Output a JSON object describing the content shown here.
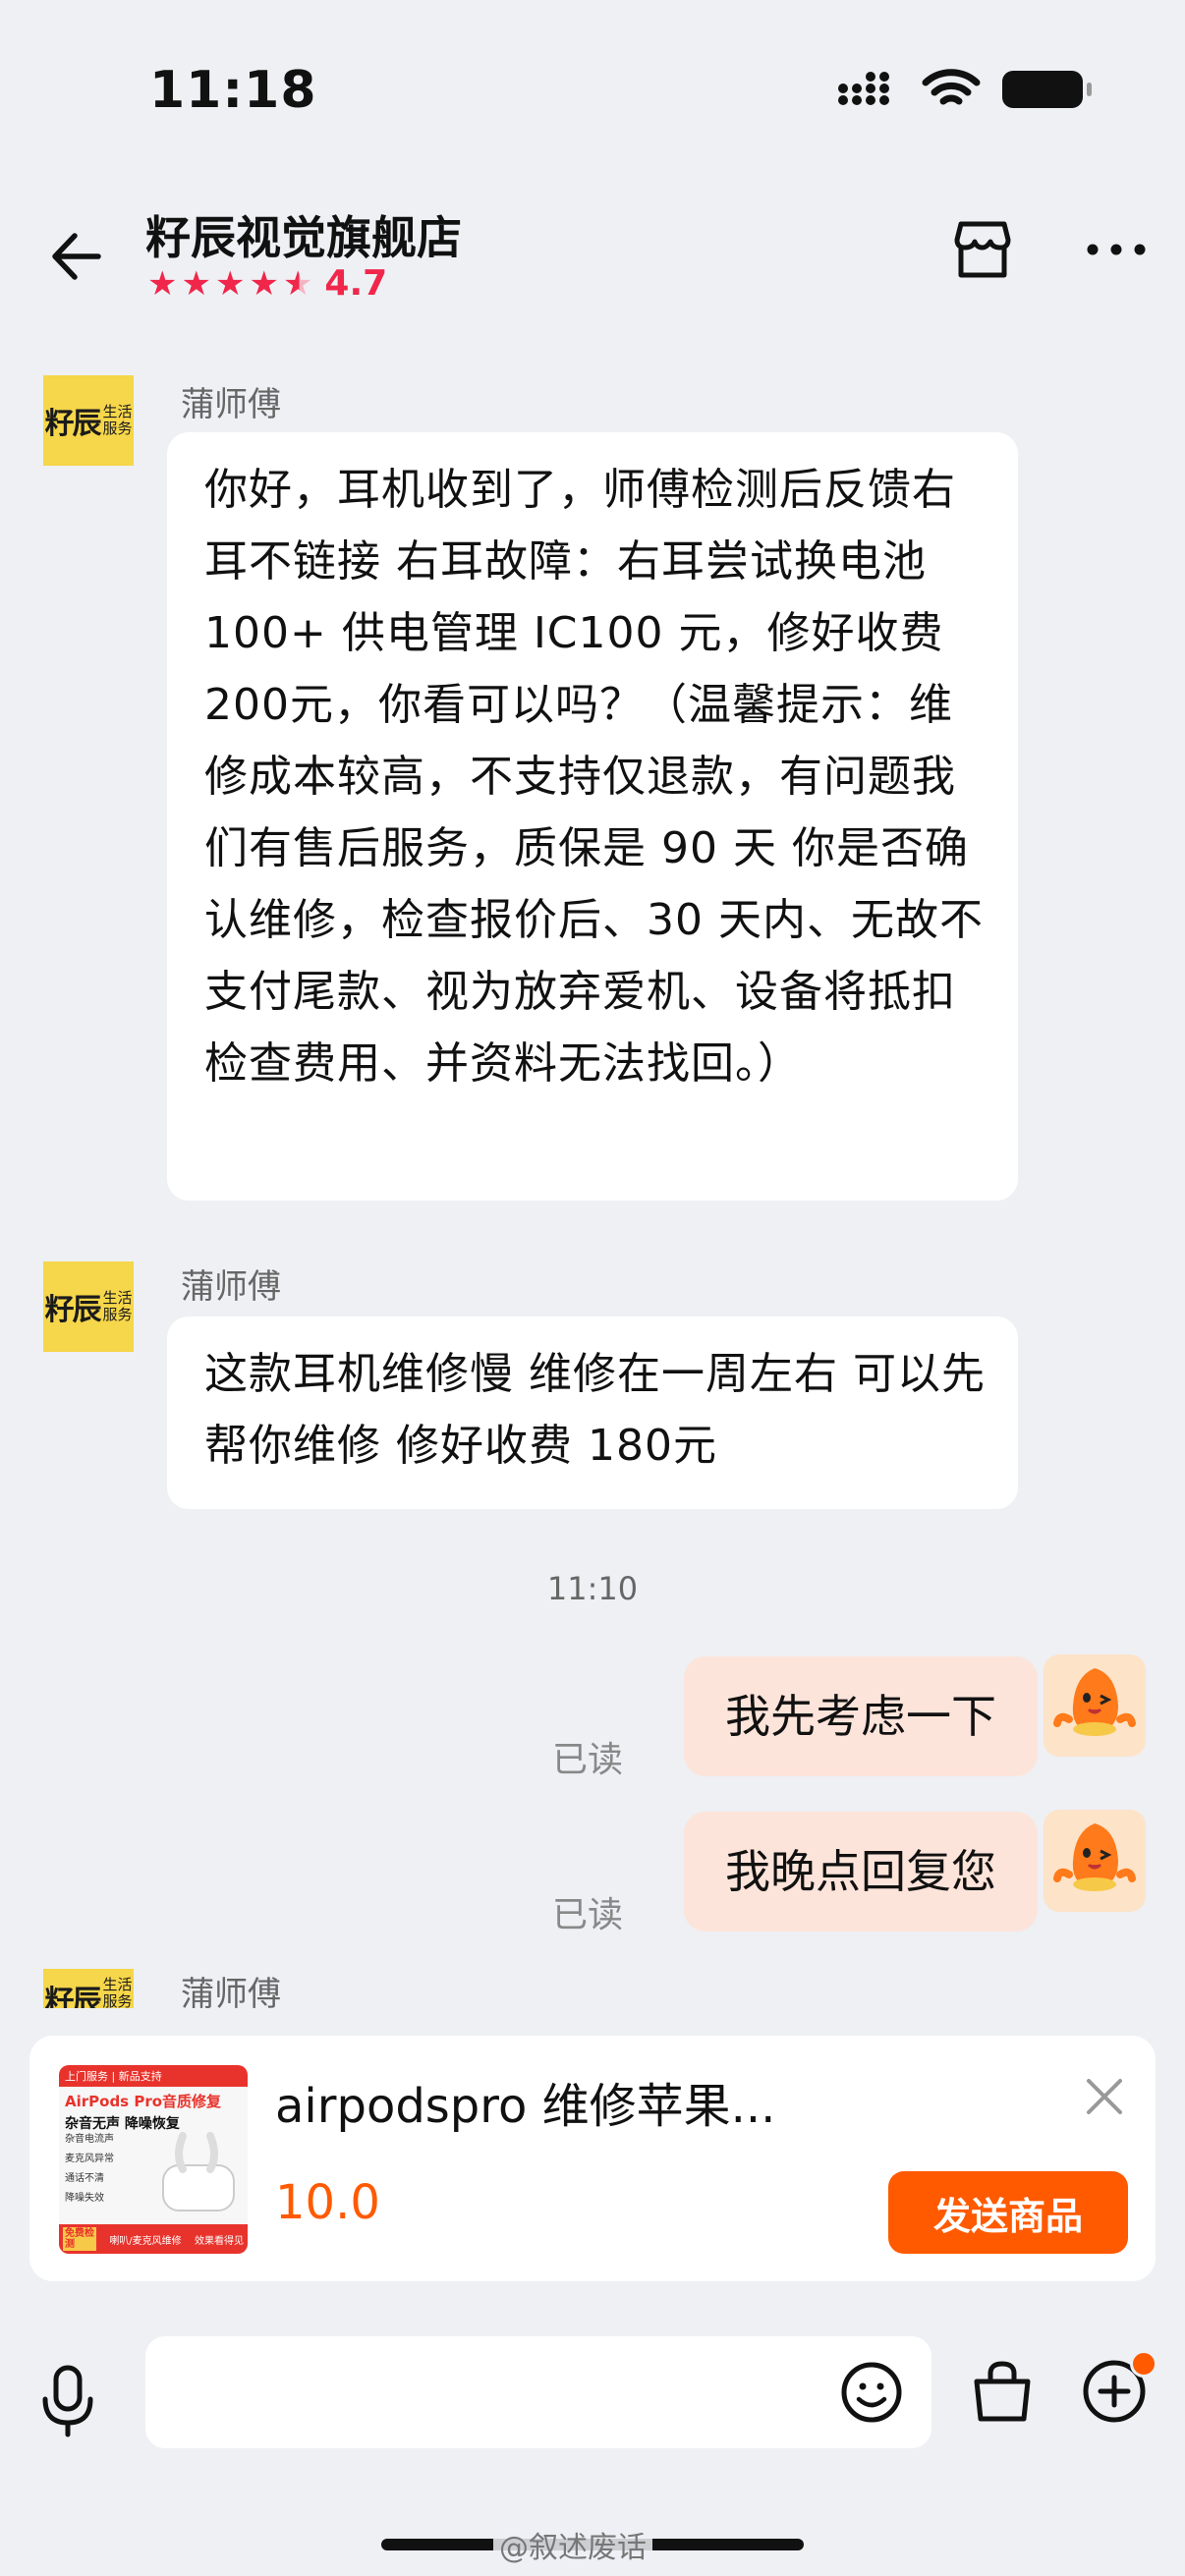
{
  "status": {
    "time": "11:18"
  },
  "header": {
    "shop_name": "籽辰视觉旗舰店",
    "rating": "4.7"
  },
  "messages": [
    {
      "sender": "蒲师傅",
      "text": "你好，耳机收到了，师傅检测后反馈右耳不链接 右耳故障：右耳尝试换电池 100+ 供电管理 IC100 元，修好收费 200元，你看可以吗？（温馨提示：维修成本较高，不支持仅退款，有问题我们有售后服务，质保是 90 天 你是否确认维修，检查报价后、30 天内、无故不支付尾款、视为放弃爱机、设备将抵扣检查费用、并资料无法找回。）"
    },
    {
      "sender": "蒲师傅",
      "text": "这款耳机维修慢 维修在一周左右 可以先帮你维修 修好收费 180元"
    },
    {
      "timestamp": "11:10"
    },
    {
      "text": "我先考虑一下",
      "status": "已读"
    },
    {
      "text": "我晚点回复您",
      "status": "已读"
    },
    {
      "sender": "蒲师傅"
    }
  ],
  "shop_avatar": {
    "left_text": "籽辰",
    "right_text": "生活服务"
  },
  "product": {
    "title": "airpodspro 维修苹果...",
    "price": "10.0",
    "send_label": "发送商品",
    "thumb": {
      "badge": "上门服务 | 新品支持",
      "headline": "AirPods Pro音质修复",
      "sub": "杂音无声 降噪恢复",
      "items": [
        "杂音电流声",
        "麦克风异常",
        "通话不清",
        "降噪失效"
      ],
      "free": "免费检测",
      "bottom": "喇叭/麦克风维修",
      "bottom_right": "效果看得见"
    }
  },
  "watermark": "@叙述废话",
  "colors": {
    "accent": "#ff5a00",
    "rating": "#f0264b",
    "out_bubble": "#fde4da"
  }
}
